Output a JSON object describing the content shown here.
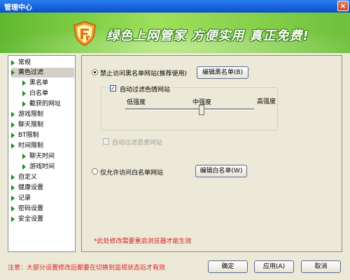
{
  "window": {
    "title": "管理中心",
    "close_glyph": "×"
  },
  "banner": {
    "slogan": "绿色上网管家  方便实用  真正免费!",
    "logo_icon": "shield-logo-icon"
  },
  "sidebar": {
    "items": [
      {
        "label": "常规",
        "level": 0,
        "selected": false
      },
      {
        "label": "黄色过滤",
        "level": 0,
        "selected": true
      },
      {
        "label": "黑名单",
        "level": 1,
        "selected": false
      },
      {
        "label": "白名单",
        "level": 1,
        "selected": false
      },
      {
        "label": "截获的网址",
        "level": 1,
        "selected": false
      },
      {
        "label": "游戏限制",
        "level": 0,
        "selected": false
      },
      {
        "label": "聊天限制",
        "level": 0,
        "selected": false
      },
      {
        "label": "BT限制",
        "level": 0,
        "selected": false
      },
      {
        "label": "时间限制",
        "level": 0,
        "selected": false
      },
      {
        "label": "聊天时间",
        "level": 1,
        "selected": false
      },
      {
        "label": "游戏时间",
        "level": 1,
        "selected": false
      },
      {
        "label": "自定义",
        "level": 0,
        "selected": false
      },
      {
        "label": "健康设置",
        "level": 0,
        "selected": false
      },
      {
        "label": "记录",
        "level": 0,
        "selected": false
      },
      {
        "label": "密码设置",
        "level": 0,
        "selected": false
      },
      {
        "label": "安全设置",
        "level": 0,
        "selected": false
      }
    ]
  },
  "content": {
    "blacklist_radio_label": "禁止访问黑名单网站(推荐使用)",
    "blacklist_radio_selected": true,
    "edit_blacklist_button": "编辑黑名单(B)",
    "auto_filter_label": "自动过滤色情网站",
    "auto_filter_checked": true,
    "strength_low": "低强度",
    "strength_mid": "中强度",
    "strength_high": "高强度",
    "strength_level_fraction": 0.5,
    "auto_filter_malicious_label": "自动过滤恶意网站",
    "auto_filter_malicious_checked": false,
    "whitelist_radio_label": "仅允许访问白名单网站",
    "whitelist_radio_selected": false,
    "edit_whitelist_button": "编辑白名单(W)",
    "restart_note": "*此处修改需要重启浏览器才能生效"
  },
  "footer": {
    "note": "注意：大部分设置修改后都要在切换到监视状态后才有效",
    "ok_button": "确定",
    "apply_button": "应用(A)",
    "cancel_button": "取消"
  },
  "colors": {
    "accent_green": "#5fb82f",
    "title_blue": "#0a4fc8",
    "warning_red": "#e02020"
  }
}
